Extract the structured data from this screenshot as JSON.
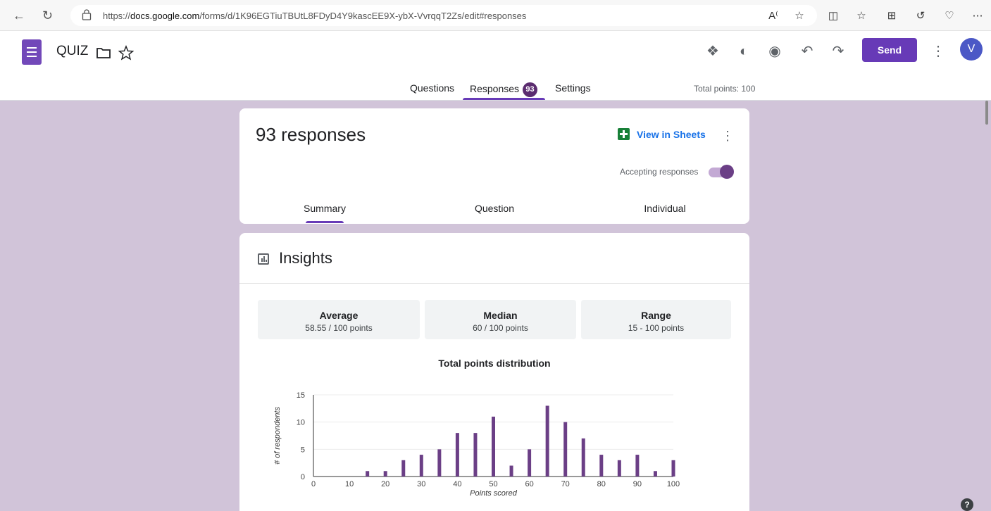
{
  "browser": {
    "url_prefix": "https://",
    "url_host": "docs.google.com",
    "url_path": "/forms/d/1K96EGTiuTBUtL8FDyD4Y9kascEE9X-ybX-VvrqqT2Zs/edit#responses"
  },
  "header": {
    "form_title": "QUIZ",
    "send_label": "Send",
    "avatar_initial": "V",
    "tabs": [
      {
        "label": "Questions"
      },
      {
        "label": "Responses",
        "badge": "93"
      },
      {
        "label": "Settings"
      }
    ],
    "total_points": "Total points: 100"
  },
  "responses_card": {
    "title": "93 responses",
    "view_in_sheets": "View in Sheets",
    "accepting_label": "Accepting responses",
    "accepting": true,
    "subtabs": [
      "Summary",
      "Question",
      "Individual"
    ],
    "active_subtab": "Summary"
  },
  "insights": {
    "title": "Insights",
    "stats": [
      {
        "label": "Average",
        "value": "58.55 / 100 points"
      },
      {
        "label": "Median",
        "value": "60 / 100 points"
      },
      {
        "label": "Range",
        "value": "15 - 100 points"
      }
    ]
  },
  "chart_data": {
    "type": "bar",
    "title": "Total points distribution",
    "xlabel": "Points scored",
    "ylabel": "# of respondents",
    "x": [
      15,
      20,
      25,
      30,
      35,
      40,
      45,
      50,
      55,
      60,
      65,
      70,
      75,
      80,
      85,
      90,
      95,
      100
    ],
    "values": [
      1,
      1,
      3,
      4,
      5,
      8,
      8,
      11,
      2,
      5,
      13,
      10,
      7,
      4,
      3,
      4,
      1,
      3
    ],
    "xlim": [
      0,
      100
    ],
    "ylim": [
      0,
      15
    ],
    "xticks": [
      0,
      10,
      20,
      30,
      40,
      50,
      60,
      70,
      80,
      90,
      100
    ],
    "yticks": [
      0,
      5,
      10,
      15
    ],
    "bar_color": "#6b3f86",
    "grid": true
  },
  "colors": {
    "accent": "#673ab7",
    "background": "#d1c4d9"
  }
}
